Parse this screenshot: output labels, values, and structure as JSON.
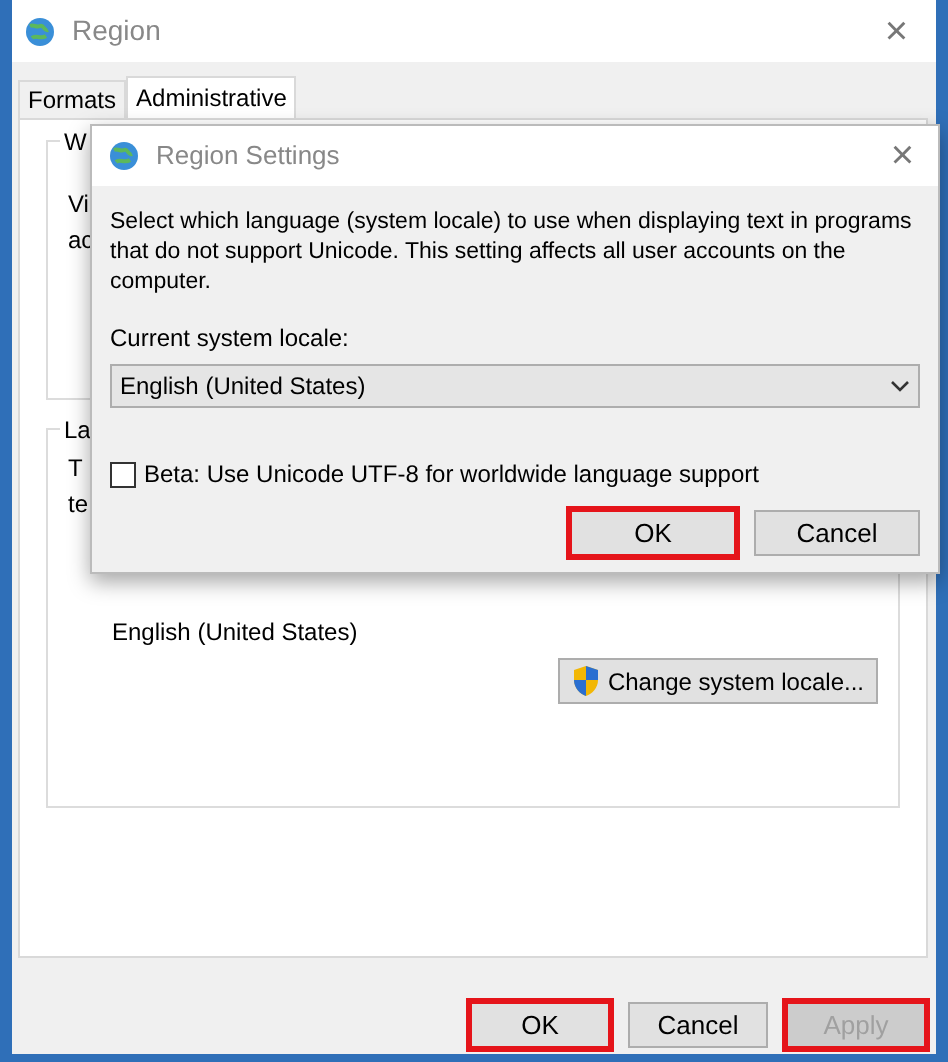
{
  "window": {
    "title": "Region",
    "close": "×"
  },
  "tabs": [
    {
      "label": "Formats",
      "selected": false
    },
    {
      "label": "Administrative",
      "selected": true
    }
  ],
  "groups": [
    {
      "legend": "W",
      "lines": [
        "Vi",
        "ac"
      ]
    },
    {
      "legend": "La",
      "lines": [
        "T",
        "te"
      ],
      "value": "English (United States)",
      "button": "Change system locale..."
    }
  ],
  "buttons": [
    {
      "label": "OK",
      "disabled": false,
      "highlighted": true
    },
    {
      "label": "Cancel",
      "disabled": false,
      "highlighted": false
    },
    {
      "label": "Apply",
      "disabled": true,
      "highlighted": true
    }
  ],
  "dialog": {
    "title": "Region Settings",
    "close": "×",
    "description": "Select which language (system locale) to use when displaying text in programs that do not support Unicode. This setting affects all user accounts on the computer.",
    "locale_label": "Current system locale:",
    "locale": "English (United States)",
    "beta": {
      "label": "Beta: Use Unicode UTF-8 for worldwide language support",
      "checked": false
    },
    "buttons": [
      {
        "label": "OK",
        "disabled": false,
        "highlighted": true
      },
      {
        "label": "Cancel",
        "disabled": false,
        "highlighted": false
      }
    ]
  }
}
